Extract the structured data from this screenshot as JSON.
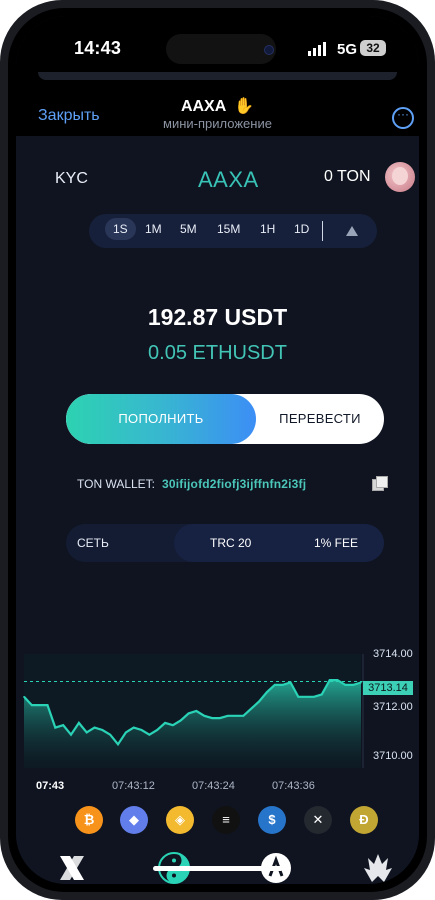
{
  "status_bar": {
    "time": "14:43",
    "network": "5G",
    "battery": "32"
  },
  "header": {
    "close_label": "Закрыть",
    "app_title": "AAXA",
    "app_subtitle": "мини-приложение"
  },
  "top": {
    "kyc_label": "KYC",
    "brand": "AAXA",
    "balance": "0 TON"
  },
  "timeframes": [
    "1S",
    "1M",
    "5M",
    "15M",
    "1H",
    "1D"
  ],
  "selected_timeframe": "1S",
  "price": {
    "amount": "192.87 USDT",
    "subline": "0.05 ETHUSDT"
  },
  "actions": {
    "deposit": "ПОПОЛНИТЬ",
    "transfer": "ПЕРЕВЕСТИ"
  },
  "wallet": {
    "label": "TON WALLET:",
    "address": "30ifijofd2fiofj3ijffnfn2i3fj"
  },
  "network": {
    "label": "СЕТЬ",
    "chain": "TRC 20",
    "fee": "1% FEE"
  },
  "chart_data": {
    "type": "area",
    "x_labels": [
      "07:43",
      "07:43:12",
      "07:43:24",
      "07:43:36"
    ],
    "y_ticks": [
      3714.0,
      3712.0,
      3710.0
    ],
    "y_tick_labels": [
      "3714.00",
      "3712.00",
      "3710.00"
    ],
    "ylim": [
      3709.5,
      3714.3
    ],
    "current_value_label": "3713.14",
    "current_value": 3713.14,
    "series": [
      {
        "values": [
          3712.5,
          3712.15,
          3712.15,
          3712.15,
          3711.2,
          3711.3,
          3710.9,
          3711.4,
          3711.0,
          3711.2,
          3711.1,
          3710.9,
          3710.5,
          3711.0,
          3711.2,
          3711.1,
          3710.9,
          3711.1,
          3711.4,
          3711.3,
          3711.5,
          3711.8,
          3711.9,
          3711.7,
          3711.6,
          3711.6,
          3711.7,
          3711.7,
          3711.7,
          3712.0,
          3712.3,
          3712.7,
          3713.0,
          3713.0,
          3713.1,
          3712.5,
          3712.5,
          3712.5,
          3712.6,
          3713.2,
          3713.2,
          3713.0,
          3713.0,
          3713.1
        ]
      }
    ],
    "grid": false
  },
  "coins": [
    {
      "name": "bitcoin",
      "glyph": "₿",
      "color": "#f7931a"
    },
    {
      "name": "ethereum",
      "glyph": "◆",
      "color": "#627eea"
    },
    {
      "name": "binance",
      "glyph": "◈",
      "color": "#f3ba2f"
    },
    {
      "name": "solana",
      "glyph": "≡",
      "color": "#111111"
    },
    {
      "name": "usdc",
      "glyph": "$",
      "color": "#2775ca"
    },
    {
      "name": "xrp",
      "glyph": "✕",
      "color": "#23292f"
    },
    {
      "name": "dogecoin",
      "glyph": "Ð",
      "color": "#c2a633"
    }
  ],
  "tabs": [
    "x-logo",
    "yin-yang",
    "a-logo",
    "emblem"
  ]
}
